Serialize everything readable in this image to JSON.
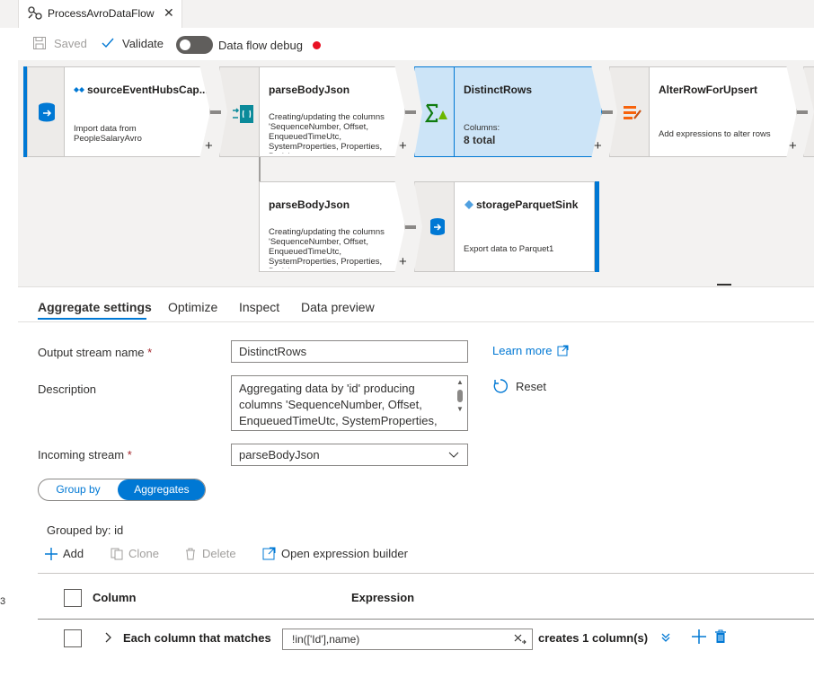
{
  "tab": {
    "title": "ProcessAvroDataFlow",
    "close": "✕"
  },
  "toolbar": {
    "saved": "Saved",
    "validate": "Validate",
    "debug": "Data flow debug"
  },
  "nodes": {
    "source": {
      "title": "sourceEventHubsCap...",
      "desc": "Import data from PeopleSalaryAvro"
    },
    "parse1": {
      "title": "parseBodyJson",
      "desc": "Creating/updating the columns 'SequenceNumber, Offset, EnqueuedTimeUtc, SystemProperties, Properties, Body'"
    },
    "distinct": {
      "title": "DistinctRows",
      "columns_label": "Columns:",
      "columns_value": "8 total"
    },
    "alter": {
      "title": "AlterRowForUpsert",
      "desc": "Add expressions to alter rows"
    },
    "parse2": {
      "title": "parseBodyJson",
      "desc": "Creating/updating the columns 'SequenceNumber, Offset, EnqueuedTimeUtc, SystemProperties, Properties, Body'"
    },
    "sink": {
      "title": "storageParquetSink",
      "desc": "Export data to Parquet1"
    }
  },
  "panel": {
    "tabs": [
      "Aggregate settings",
      "Optimize",
      "Inspect",
      "Data preview"
    ],
    "output_stream_label": "Output stream name",
    "output_stream_value": "DistinctRows",
    "learn_more": "Learn more",
    "description_label": "Description",
    "description_value": "Aggregating data by 'id' producing columns 'SequenceNumber, Offset, EnqueuedTimeUtc, SystemProperties, Properties, Body'",
    "reset": "Reset",
    "incoming_label": "Incoming stream",
    "incoming_value": "parseBodyJson",
    "group_by": "Group by",
    "aggregates": "Aggregates",
    "grouped_by": "Grouped by: id",
    "actions": {
      "add": "Add",
      "clone": "Clone",
      "delete": "Delete",
      "open_builder": "Open expression builder"
    },
    "table": {
      "col_column": "Column",
      "col_expression": "Expression",
      "row_label": "Each column that matches",
      "row_expression": "!in(['Id'],name)",
      "row_creates": "creates 1 column(s)"
    },
    "required_mark": "*"
  },
  "edge_fragment": "3",
  "colors": {
    "accent": "#0078d4",
    "selected_node": "#cce4f7",
    "debug_dot": "#e81123"
  }
}
